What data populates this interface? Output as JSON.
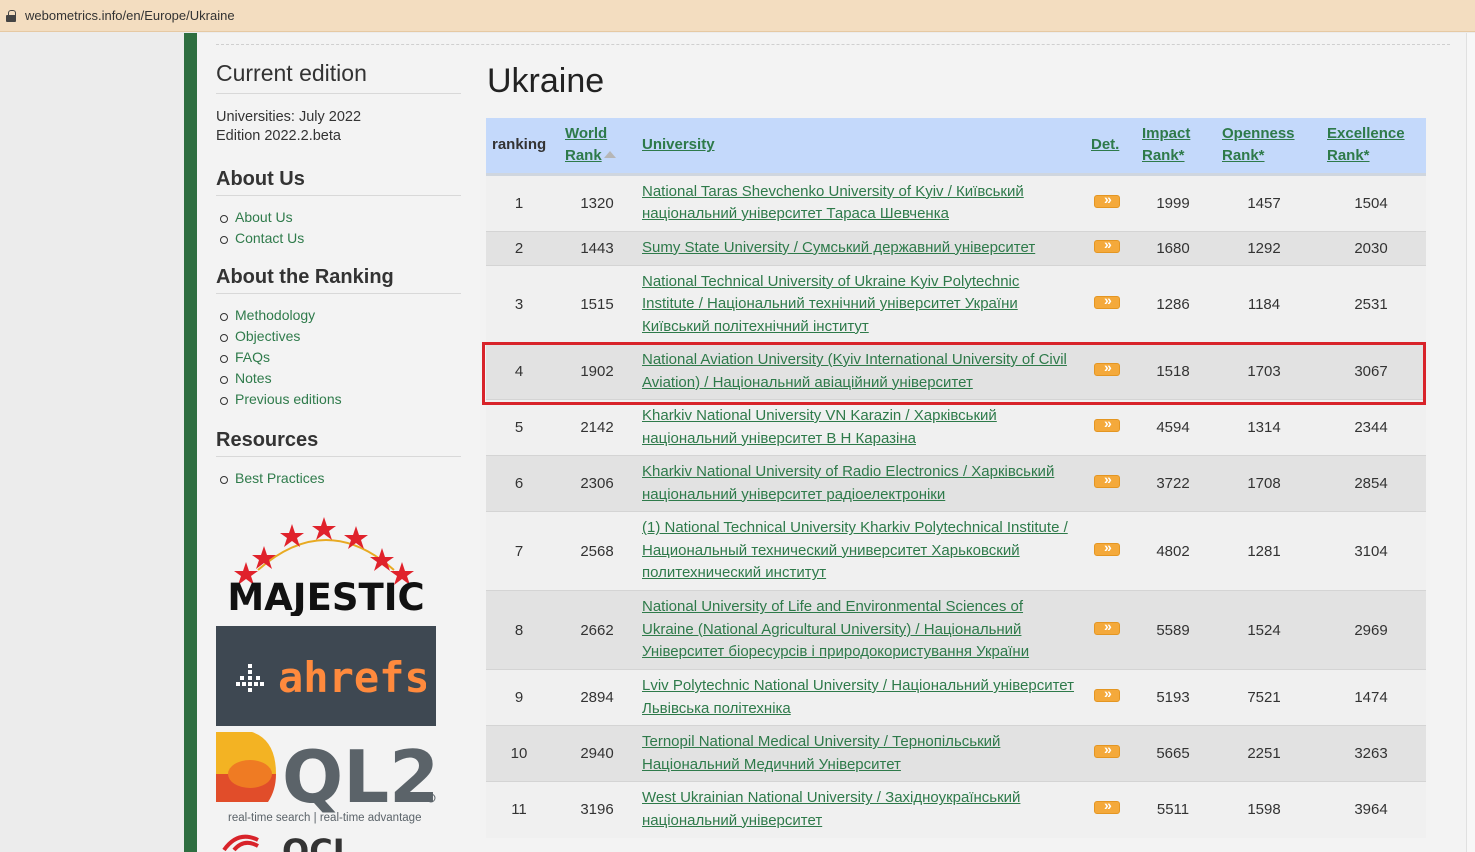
{
  "browser": {
    "url": "webometrics.info/en/Europe/Ukraine"
  },
  "sidebar": {
    "current_edition": {
      "title": "Current edition",
      "line1": "Universities: July 2022",
      "line2": "Edition 2022.2.beta"
    },
    "about_us": {
      "title": "About Us",
      "items": [
        "About Us",
        "Contact Us"
      ]
    },
    "about_ranking": {
      "title": "About the Ranking",
      "items": [
        "Methodology",
        "Objectives",
        "FAQs",
        "Notes",
        "Previous editions"
      ]
    },
    "resources": {
      "title": "Resources",
      "items": [
        "Best Practices"
      ]
    },
    "logos": {
      "majestic": "MAJESTIC",
      "ahrefs": "ahrefs",
      "ql2": "QL2",
      "ql2_tagline": "real-time search | real-time advantage",
      "cut_logo": "QCI"
    }
  },
  "main": {
    "title": "Ukraine",
    "table": {
      "headers": {
        "ranking": "ranking",
        "world_rank_1": "World",
        "world_rank_2": "Rank",
        "university": "University",
        "det": "Det.",
        "impact_1": "Impact",
        "impact_2": "Rank*",
        "openness_1": "Openness",
        "openness_2": "Rank*",
        "excellence_1": "Excellence",
        "excellence_2": "Rank*"
      },
      "rows": [
        {
          "ranking": "1",
          "world": "1320",
          "university": "National Taras Shevchenko University of Kyiv / Київський національний університет Тараса Шевченка",
          "impact": "1999",
          "openness": "1457",
          "excellence": "1504"
        },
        {
          "ranking": "2",
          "world": "1443",
          "university": "Sumy State University / Сумський державний університет",
          "impact": "1680",
          "openness": "1292",
          "excellence": "2030"
        },
        {
          "ranking": "3",
          "world": "1515",
          "university": "National Technical University of Ukraine Kyiv Polytechnic Institute / Національний технічний університет України Київський політехнічний інститут",
          "impact": "1286",
          "openness": "1184",
          "excellence": "2531"
        },
        {
          "ranking": "4",
          "world": "1902",
          "university": "National Aviation University (Kyiv International University of Civil Aviation) / Національний авіаційний університет",
          "impact": "1518",
          "openness": "1703",
          "excellence": "3067"
        },
        {
          "ranking": "5",
          "world": "2142",
          "university": "Kharkiv National University VN Karazin / Харківський національний університет В Н Каразіна",
          "impact": "4594",
          "openness": "1314",
          "excellence": "2344"
        },
        {
          "ranking": "6",
          "world": "2306",
          "university": "Kharkiv National University of Radio Electronics / Харківський національний університет радіоелектроніки",
          "impact": "3722",
          "openness": "1708",
          "excellence": "2854"
        },
        {
          "ranking": "7",
          "world": "2568",
          "university": "(1) National Technical University Kharkiv Polytechnical Institute / Национальный технический университет Харьковский политехнический институт",
          "impact": "4802",
          "openness": "1281",
          "excellence": "3104"
        },
        {
          "ranking": "8",
          "world": "2662",
          "university": "National University of Life and Environmental Sciences of Ukraine (National Agricultural University) / Національний Університет біоресурсів і природокористування України",
          "impact": "5589",
          "openness": "1524",
          "excellence": "2969"
        },
        {
          "ranking": "9",
          "world": "2894",
          "university": "Lviv Polytechnic National University / Національний університет Львівська політехніка",
          "impact": "5193",
          "openness": "7521",
          "excellence": "1474"
        },
        {
          "ranking": "10",
          "world": "2940",
          "university": "Ternopil National Medical University / Тернопільський Національний Медичний Університет",
          "impact": "5665",
          "openness": "2251",
          "excellence": "3263"
        },
        {
          "ranking": "11",
          "world": "3196",
          "university": "West Ukrainian National University / Західноукраїнський національний університет",
          "impact": "5511",
          "openness": "1598",
          "excellence": "3964"
        }
      ]
    }
  },
  "colors": {
    "green_bar": "#2e6e40",
    "link": "#2e7a4a",
    "header_bg": "#c4d9fb",
    "highlight": "#d8232a",
    "det_icon": "#f4a93b"
  }
}
